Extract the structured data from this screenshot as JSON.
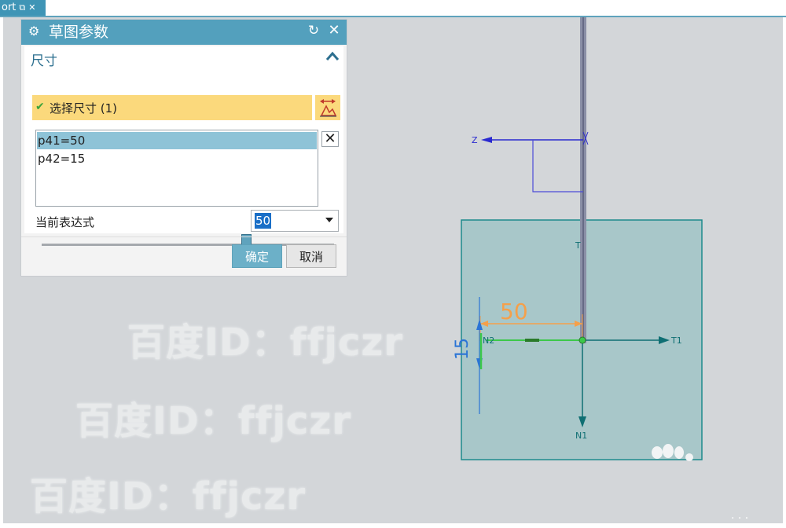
{
  "tab": {
    "label": "ort",
    "pin": "⧉",
    "close": "✕"
  },
  "dialog": {
    "title": "草图参数",
    "reset_glyph": "↻",
    "close_glyph": "✕",
    "group": {
      "header": "尺寸",
      "select_label": "选择尺寸 (1)",
      "list_items": [
        "p41=50",
        "p42=15"
      ],
      "remove_glyph": "✕",
      "expression_label": "当前表达式",
      "expression_value": "50",
      "slider_level": 0.7
    },
    "ok_label": "确定",
    "cancel_label": "取消"
  },
  "scene": {
    "axis_z": "Z",
    "axis_t1": "T1",
    "axis_n1": "N1",
    "axis_n2": "N2",
    "axis_t": "T",
    "dim_horizontal": "50",
    "dim_vertical": "15"
  },
  "watermarks": [
    "百度ID：ffjczr",
    "百度ID：ffjczr",
    "百度ID：ffjczr"
  ],
  "colors": {
    "accent": "#53a0bd",
    "highlight": "#fbd97c",
    "dimension": "#f5a04a",
    "axis_blue": "#2a2ad0",
    "axis_teal": "#0f6f73"
  }
}
